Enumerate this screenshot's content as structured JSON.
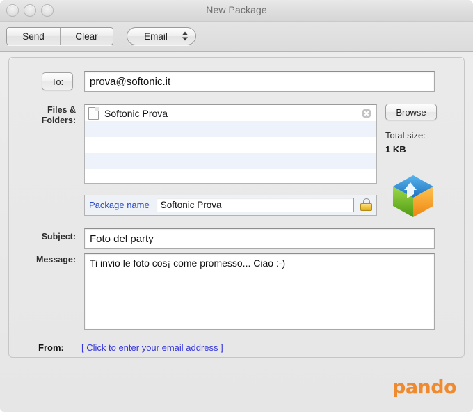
{
  "window": {
    "title": "New Package",
    "traffic_lights": [
      "close",
      "minimize",
      "zoom"
    ]
  },
  "toolbar": {
    "send_label": "Send",
    "clear_label": "Clear",
    "mode_selected": "Email",
    "mode_options": [
      "Email"
    ]
  },
  "form": {
    "to_button_label": "To:",
    "to_value": "prova@softonic.it",
    "files_label_line1": "Files &",
    "files_label_line2": "Folders:",
    "files": [
      {
        "name": "Softonic Prova",
        "icon": "document-icon",
        "remove": "remove-icon"
      }
    ],
    "empty_rows": 4,
    "browse_label": "Browse",
    "total_size_label": "Total size:",
    "total_size_value": "1 KB",
    "package_name_label": "Package name",
    "package_name_value": "Softonic Prova",
    "lock_icon": "lock-icon",
    "subject_label": "Subject:",
    "subject_value": "Foto del party",
    "message_label": "Message:",
    "message_value": "Ti invio le foto cos¡ come promesso... Ciao :-)",
    "from_label": "From:",
    "from_link_text": "[ Click to enter your email address ]"
  },
  "branding": {
    "wordmark": "pando",
    "cube_icon": "pando-cube-icon"
  },
  "colors": {
    "accent_orange": "#f08a2e",
    "link_blue": "#3636e0",
    "package_link_blue": "#2a4bc4",
    "row_stripe": "#eef3fb",
    "cube_top": "#2e8ed6",
    "cube_left": "#79c225",
    "cube_right": "#f5a623"
  }
}
